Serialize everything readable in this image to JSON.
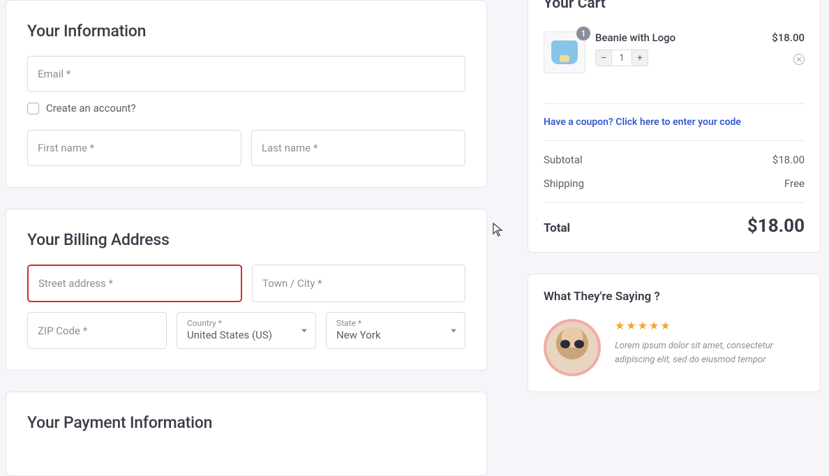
{
  "info": {
    "title": "Your Information",
    "email_placeholder": "Email *",
    "create_account_label": "Create an account?",
    "first_name_placeholder": "First name *",
    "last_name_placeholder": "Last name *"
  },
  "billing": {
    "title": "Your Billing Address",
    "street_placeholder": "Street address *",
    "city_placeholder": "Town / City *",
    "zip_placeholder": "ZIP Code *",
    "country_label": "Country *",
    "country_value": "United States (US)",
    "state_label": "State *",
    "state_value": "New York"
  },
  "payment": {
    "title": "Your Payment Information"
  },
  "cart": {
    "title": "Your Cart",
    "items": [
      {
        "name": "Beanie with Logo",
        "qty": "1",
        "price": "$18.00",
        "badge": "1"
      }
    ],
    "coupon_text": "Have a coupon? Click here to enter your code",
    "subtotal_label": "Subtotal",
    "subtotal_value": "$18.00",
    "shipping_label": "Shipping",
    "shipping_value": "Free",
    "total_label": "Total",
    "total_value": "$18.00",
    "qty_minus": "–",
    "qty_plus": "+"
  },
  "testimonial": {
    "title": "What They're Saying ?",
    "stars": "★★★★★",
    "text": "Lorem ipsum dolor sit amet, consectetur adipiscing elit, sed do eiusmod tempor"
  }
}
